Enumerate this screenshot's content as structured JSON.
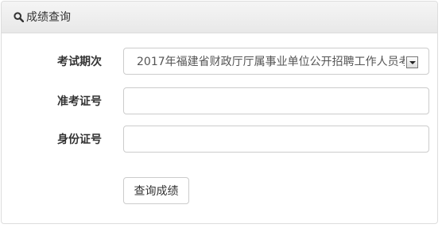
{
  "panel": {
    "title": "成绩查询",
    "icon": "search-icon"
  },
  "form": {
    "exam_period": {
      "label": "考试期次",
      "selected": "2017年福建省财政厅厅属事业单位公开招聘工作人员考"
    },
    "exam_number": {
      "label": "准考证号",
      "value": ""
    },
    "id_number": {
      "label": "身份证号",
      "value": ""
    },
    "submit_label": "查询成绩"
  }
}
